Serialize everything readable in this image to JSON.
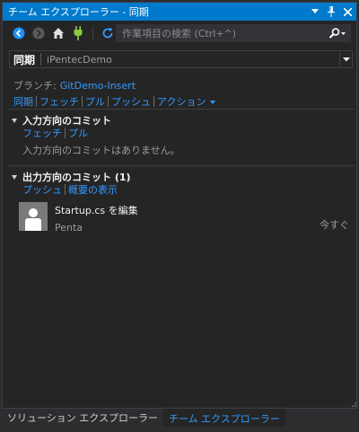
{
  "window": {
    "title": "チーム エクスプローラー - 同期",
    "pin_glyph": "▾",
    "pushpin_glyph": "ᛘ",
    "close_glyph": "✕"
  },
  "toolbar": {
    "search_placeholder": "作業項目の検索 (Ctrl+^)",
    "icons": [
      "back-icon",
      "forward-icon",
      "home-icon",
      "connect-icon",
      "refresh-icon",
      "search-icon"
    ]
  },
  "page": {
    "title": "同期",
    "repo": "iPentecDemo"
  },
  "branch": {
    "label": "ブランチ:",
    "name": "GitDemo-Insert"
  },
  "actions": [
    "同期",
    "フェッチ",
    "プル",
    "プッシュ",
    "アクション"
  ],
  "incoming": {
    "title": "入力方向のコミット",
    "links": [
      "フェッチ",
      "プル"
    ],
    "empty_message": "入力方向のコミットはありません。"
  },
  "outgoing": {
    "title": "出力方向のコミット (1)",
    "links": [
      "プッシュ",
      "概要の表示"
    ],
    "commits": [
      {
        "message": "Startup.cs を編集",
        "author": "Penta",
        "time": "今すぐ"
      }
    ]
  },
  "tabs": [
    {
      "label": "ソリューション エクスプローラー",
      "active": false
    },
    {
      "label": "チーム エクスプローラー",
      "active": true
    }
  ],
  "colors": {
    "accent": "#007acc",
    "link": "#3399ff",
    "background": "#252526"
  }
}
